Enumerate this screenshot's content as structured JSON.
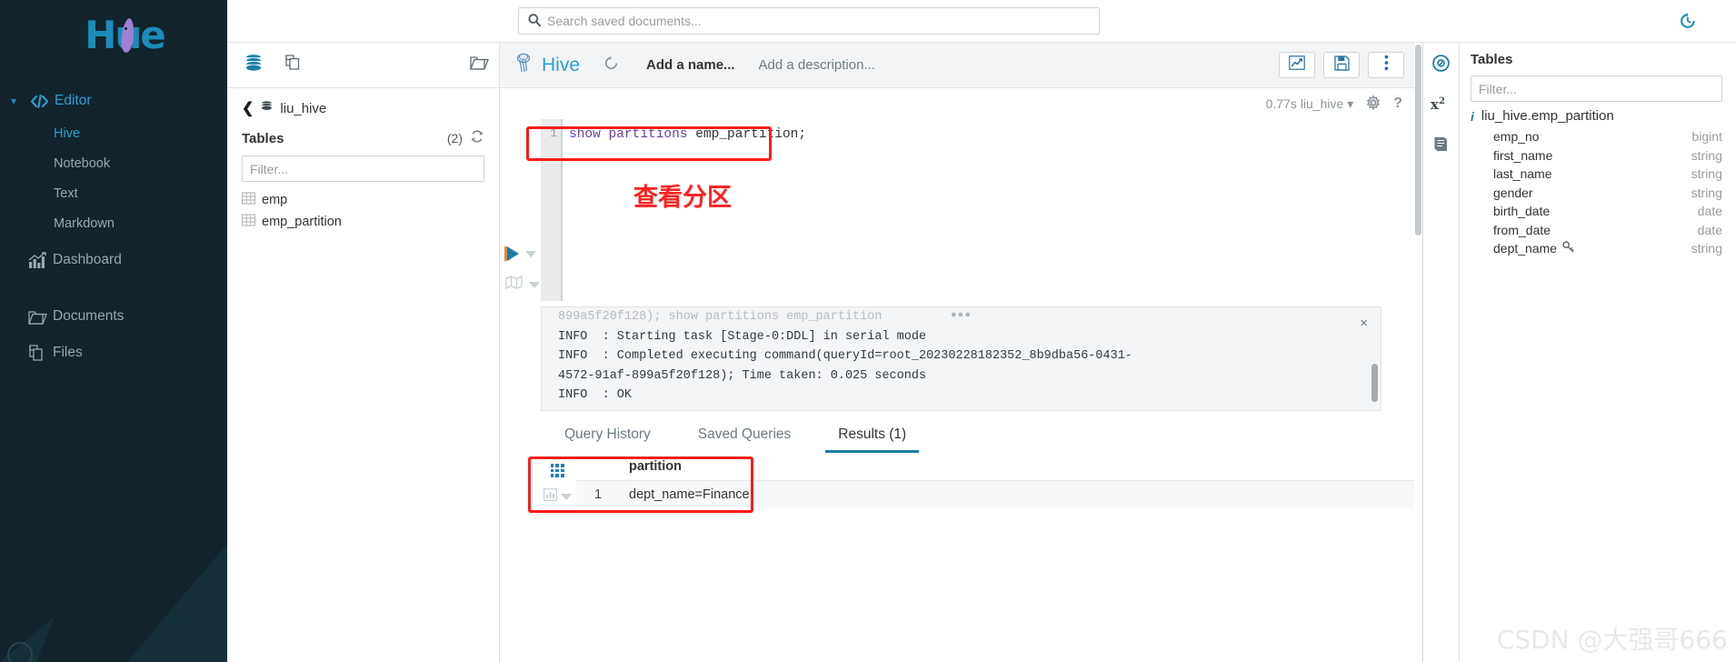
{
  "app": {
    "logo_text": "Hue"
  },
  "sidebar": {
    "editor": {
      "label": "Editor",
      "icon": "code-icon"
    },
    "editor_children": [
      {
        "label": "Hive",
        "active": true
      },
      {
        "label": "Notebook",
        "active": false
      },
      {
        "label": "Text",
        "active": false
      },
      {
        "label": "Markdown",
        "active": false
      }
    ],
    "main_items": [
      {
        "label": "Dashboard",
        "icon": "chart-icon"
      },
      {
        "label": "Documents",
        "icon": "folder-open-icon"
      },
      {
        "label": "Files",
        "icon": "files-icon"
      }
    ]
  },
  "search": {
    "placeholder": "Search saved documents...",
    "icon": "search-icon"
  },
  "assist": {
    "tab_icons": [
      "database-icon",
      "documents-icon",
      "folder-open-icon"
    ],
    "breadcrumb_db": "liu_hive",
    "tables_label": "Tables",
    "tables_count": "(2)",
    "filter_placeholder": "Filter...",
    "tables": [
      {
        "name": "emp"
      },
      {
        "name": "emp_partition"
      }
    ]
  },
  "editor": {
    "engine": "Hive",
    "history_icon": "history-icon",
    "name_placeholder": "Add a name...",
    "description_placeholder": "Add a description...",
    "buttons": [
      {
        "name": "chart-button",
        "icon": "line-chart-icon"
      },
      {
        "name": "save-button",
        "icon": "floppy-icon"
      },
      {
        "name": "more-button",
        "icon": "vertical-dots-icon"
      }
    ],
    "status_time": "0.77s",
    "status_db": "liu_hive",
    "gear_icon": "gear-icon",
    "help_icon": "question-mark-icon",
    "line_number": "1",
    "sql_keyword": "show partitions ",
    "sql_identifier": "emp_partition;",
    "annotation_cn": "查看分区",
    "run_button": "play-icon",
    "map_button": "map-icon"
  },
  "logs": {
    "lines": [
      {
        "text": "899a5f20f128); show partitions emp_partition",
        "faded": true
      },
      {
        "text": "INFO  : Starting task [Stage-0:DDL] in serial mode",
        "faded": false
      },
      {
        "text": "INFO  : Completed executing command(queryId=root_20230228182352_8b9dba56-0431-",
        "faded": false
      },
      {
        "text": "4572-91af-899a5f20f128); Time taken: 0.025 seconds",
        "faded": false
      },
      {
        "text": "INFO  : OK",
        "faded": false
      }
    ],
    "close_label": "×"
  },
  "result_tabs": [
    {
      "label": "Query History",
      "active": false
    },
    {
      "label": "Saved Queries",
      "active": false
    },
    {
      "label": "Results (1)",
      "active": true
    }
  ],
  "results": {
    "columns": [
      "partition"
    ],
    "rows": [
      {
        "index": "1",
        "partition": "dept_name=Finance"
      }
    ]
  },
  "right_panel": {
    "rail_icons": [
      "compass-icon",
      "function-icon",
      "book-icon"
    ],
    "title": "Tables",
    "filter_placeholder": "Filter...",
    "table_name": "liu_hive.emp_partition",
    "columns": [
      {
        "name": "emp_no",
        "type": "bigint",
        "key": false
      },
      {
        "name": "first_name",
        "type": "string",
        "key": false
      },
      {
        "name": "last_name",
        "type": "string",
        "key": false
      },
      {
        "name": "gender",
        "type": "string",
        "key": false
      },
      {
        "name": "birth_date",
        "type": "date",
        "key": false
      },
      {
        "name": "from_date",
        "type": "date",
        "key": false
      },
      {
        "name": "dept_name",
        "type": "string",
        "key": true
      }
    ]
  },
  "watermark": "CSDN @大强哥666",
  "colors": {
    "sidebar_bg": "#13242c",
    "accent": "#1a8cba",
    "highlight_red": "#fb1b1b",
    "logo_purple": "#9f7fd1"
  }
}
